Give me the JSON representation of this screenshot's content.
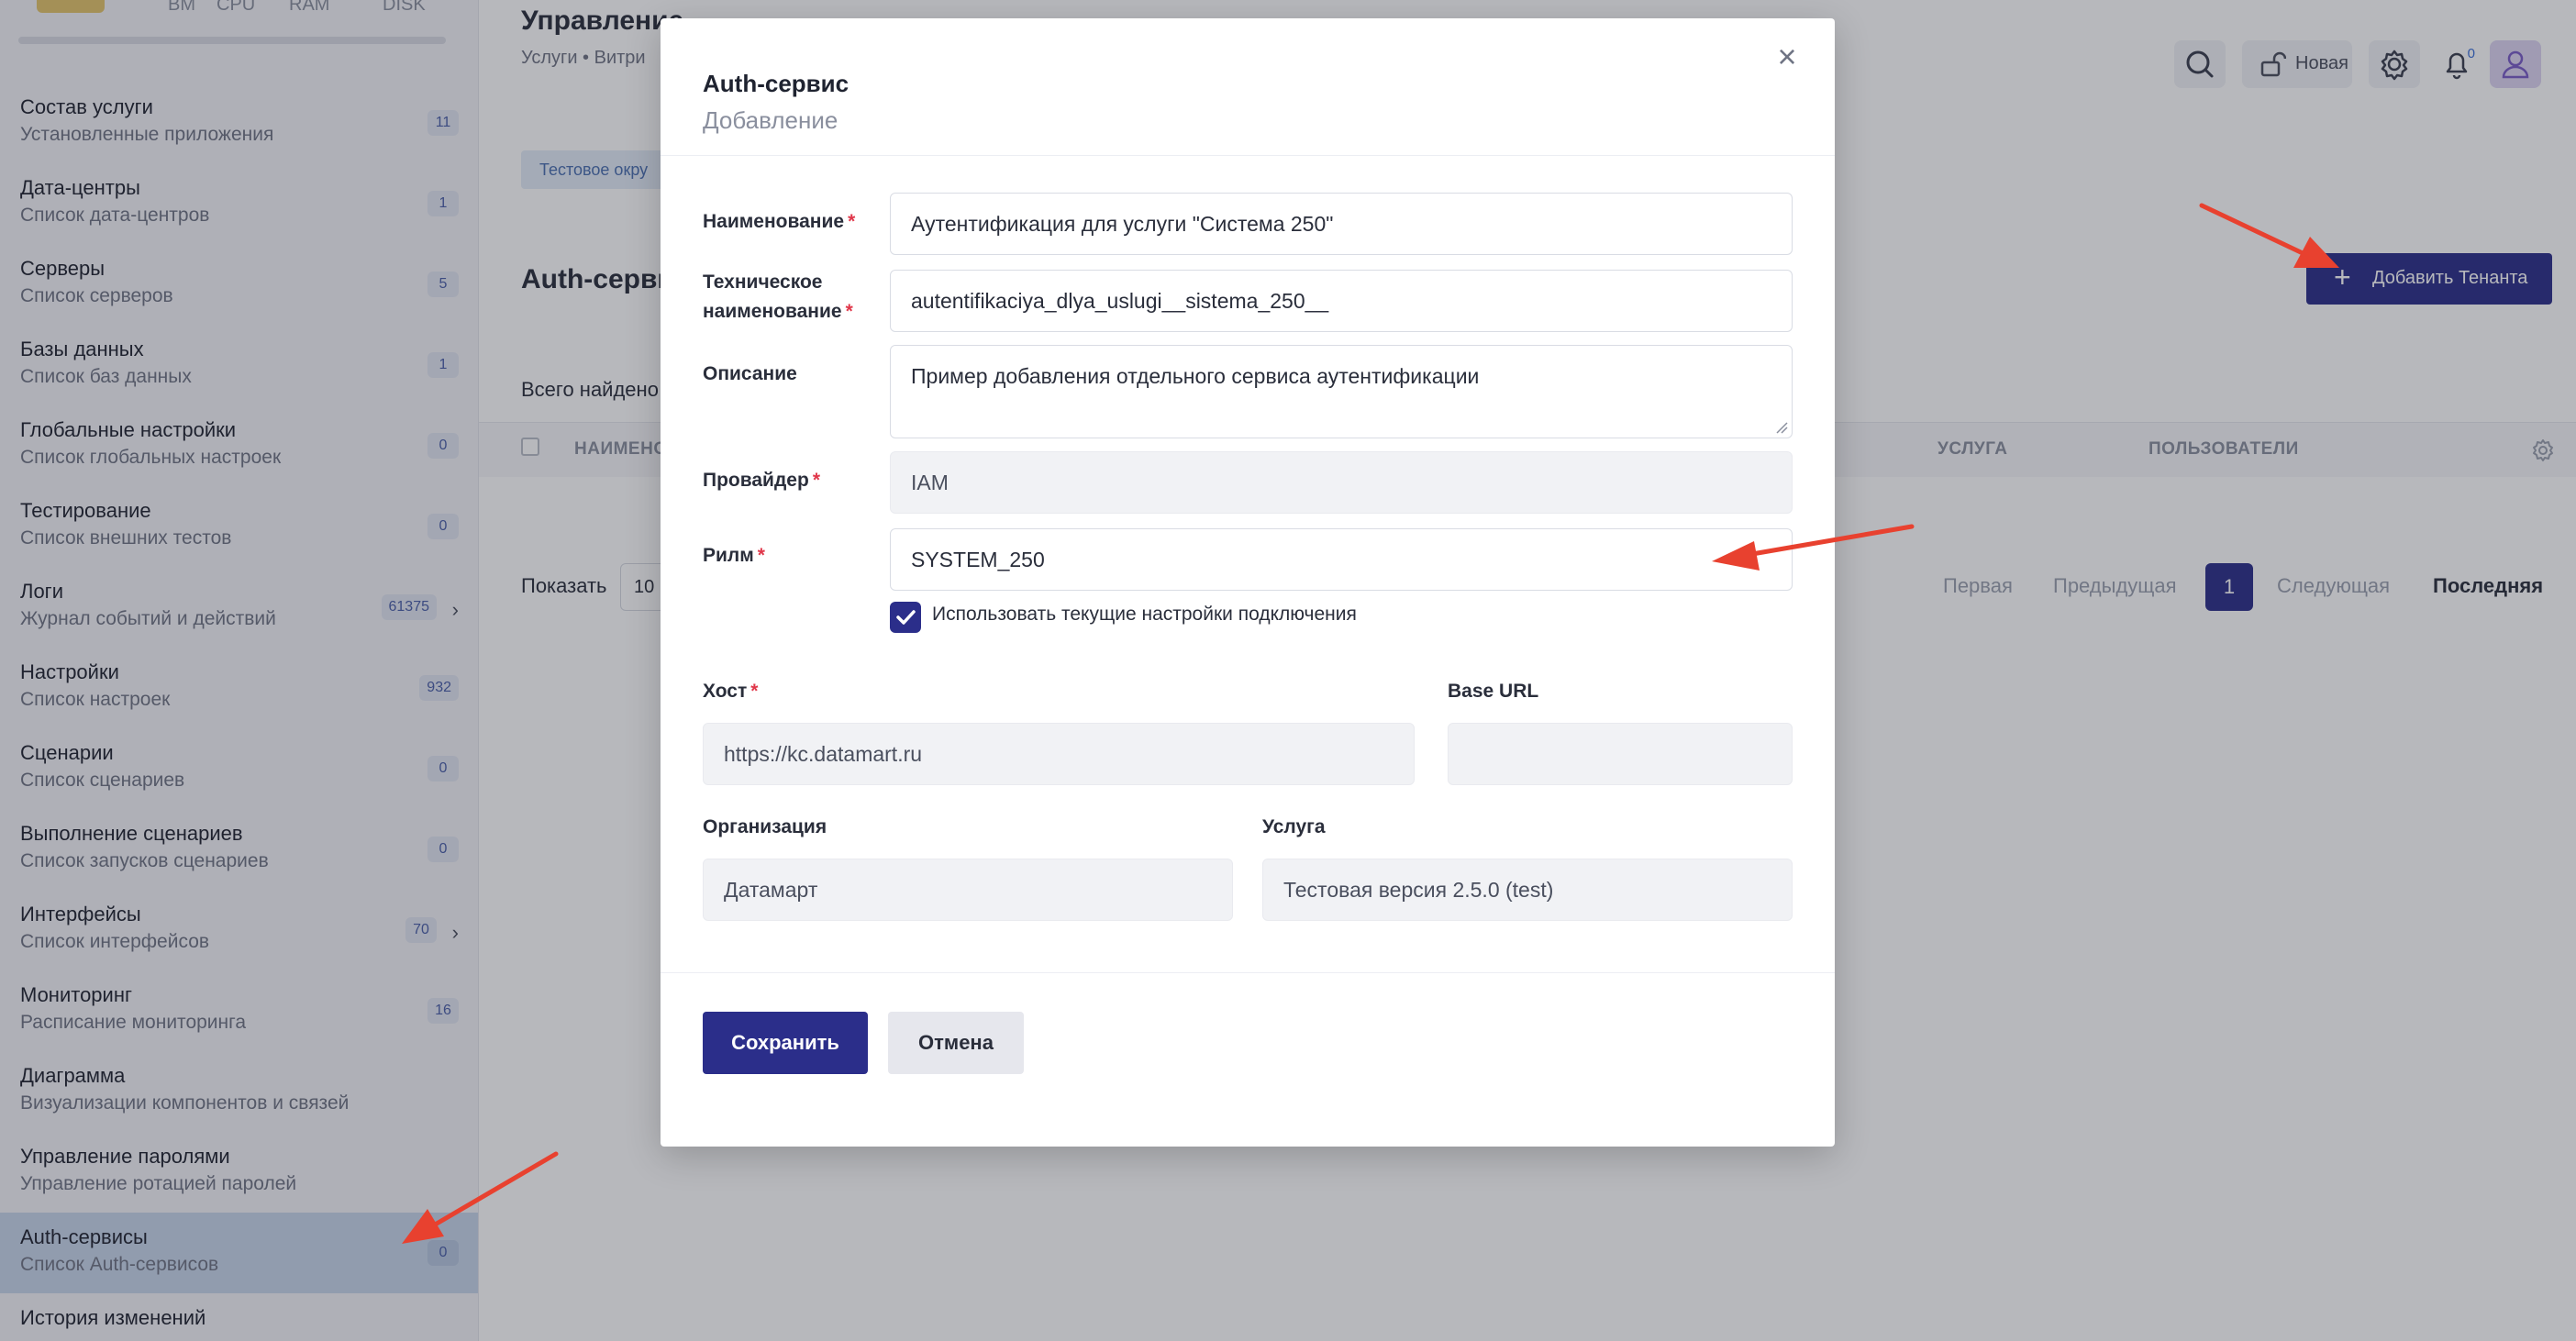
{
  "colors": {
    "accent": "#2b2e8a",
    "required": "#e0374a",
    "arrow": "#e8412f",
    "badge_text": "#4a5fa8",
    "active_bg": "#c8d6ea"
  },
  "sidebar": {
    "resources": [
      "BM",
      "CPU",
      "RAM",
      "DISK"
    ],
    "items": [
      {
        "title": "Состав услуги",
        "subtitle": "Установленные приложения",
        "badge": "11",
        "chevron": false,
        "active": false
      },
      {
        "title": "Дата-центры",
        "subtitle": "Список дата-центров",
        "badge": "1",
        "chevron": false,
        "active": false
      },
      {
        "title": "Серверы",
        "subtitle": "Список серверов",
        "badge": "5",
        "chevron": false,
        "active": false
      },
      {
        "title": "Базы данных",
        "subtitle": "Список баз данных",
        "badge": "1",
        "chevron": false,
        "active": false
      },
      {
        "title": "Глобальные настройки",
        "subtitle": "Список глобальных настроек",
        "badge": "0",
        "chevron": false,
        "active": false
      },
      {
        "title": "Тестирование",
        "subtitle": "Список внешних тестов",
        "badge": "0",
        "chevron": false,
        "active": false
      },
      {
        "title": "Логи",
        "subtitle": "Журнал событий и действий",
        "badge": "61375",
        "chevron": true,
        "active": false
      },
      {
        "title": "Настройки",
        "subtitle": "Список настроек",
        "badge": "932",
        "chevron": false,
        "active": false
      },
      {
        "title": "Сценарии",
        "subtitle": "Список сценариев",
        "badge": "0",
        "chevron": false,
        "active": false
      },
      {
        "title": "Выполнение сценариев",
        "subtitle": "Список запусков сценариев",
        "badge": "0",
        "chevron": false,
        "active": false
      },
      {
        "title": "Интерфейсы",
        "subtitle": "Список интерфейсов",
        "badge": "70",
        "chevron": true,
        "active": false
      },
      {
        "title": "Мониторинг",
        "subtitle": "Расписание мониторинга",
        "badge": "16",
        "chevron": false,
        "active": false
      },
      {
        "title": "Диаграмма",
        "subtitle": "Визуализации компонентов и связей",
        "badge": "",
        "chevron": false,
        "active": false
      },
      {
        "title": "Управление паролями",
        "subtitle": "Управление ротацией паролей",
        "badge": "",
        "chevron": false,
        "active": false
      },
      {
        "title": "Auth-сервисы",
        "subtitle": "Список Auth-сервисов",
        "badge": "0",
        "chevron": false,
        "active": true
      },
      {
        "title": "История изменений",
        "subtitle": "",
        "badge": "",
        "chevron": false,
        "active": false
      }
    ]
  },
  "header": {
    "page_title": "Управление",
    "breadcrumb": "Услуги • Витри",
    "env_chip": "Тестовое окру",
    "new_label": "Новая",
    "notif_count": "0"
  },
  "content": {
    "section_title": "Auth-сервис",
    "add_tenant": "Добавить Тенанта",
    "total_found": "Всего найдено",
    "columns": [
      "НАИМЕНО",
      "УСЛУГА",
      "ПОЛЬЗОВАТЕЛИ"
    ],
    "show_label": "Показать",
    "show_value": "10",
    "pager": {
      "first": "Первая",
      "prev": "Предыдущая",
      "current": "1",
      "next": "Следующая",
      "last": "Последняя"
    }
  },
  "modal": {
    "title": "Auth-сервис",
    "subtitle": "Добавление",
    "close": "×",
    "fields": {
      "name": {
        "label": "Наименование",
        "value": "Аутентификация для услуги \"Система 250\""
      },
      "tech_name": {
        "label1": "Техническое",
        "label2": "наименование",
        "value": "autentifikaciya_dlya_uslugi__sistema_250__"
      },
      "description": {
        "label": "Описание",
        "value": "Пример добавления отдельного сервиса аутентификации"
      },
      "provider": {
        "label": "Провайдер",
        "value": "IAM"
      },
      "realm": {
        "label": "Рилм",
        "value": "SYSTEM_250"
      },
      "use_current": {
        "label": "Использовать текущие настройки подключения",
        "checked": true
      },
      "host": {
        "label": "Хост",
        "value": "https://kc.datamart.ru"
      },
      "base_url": {
        "label": "Base URL",
        "value": ""
      },
      "organization": {
        "label": "Организация",
        "value": "Датамарт"
      },
      "service": {
        "label": "Услуга",
        "value": "Тестовая версия 2.5.0 (test)"
      }
    },
    "required_mark": "*",
    "save": "Сохранить",
    "cancel": "Отмена"
  }
}
